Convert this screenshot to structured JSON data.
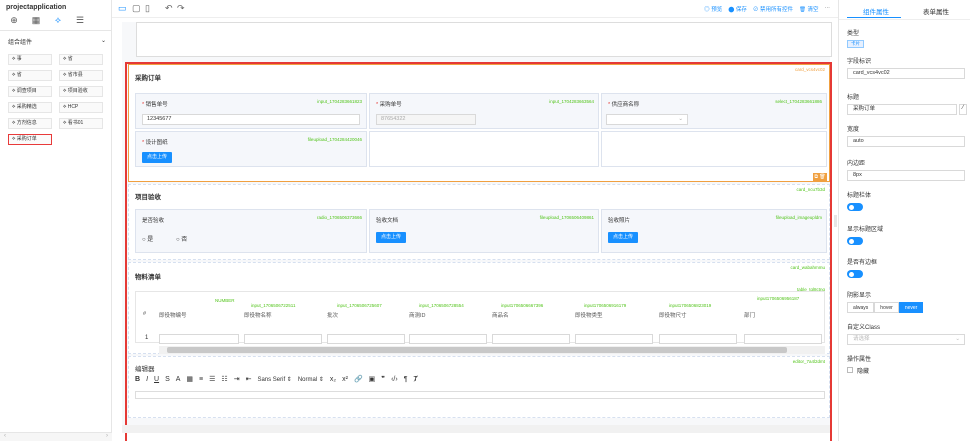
{
  "app": {
    "title": "projectapplication"
  },
  "left": {
    "tabs": [
      {
        "icon": "grid-icon"
      },
      {
        "icon": "blocks-icon"
      },
      {
        "icon": "component-icon"
      },
      {
        "icon": "list-icon"
      }
    ],
    "group_title": "组合组件",
    "group_chevron": "⌄",
    "components": [
      "事",
      "省",
      "省市县",
      "调查项目",
      "项目验收",
      "采购精选",
      "HCP",
      "方剂信息",
      "看书01",
      "采购订单"
    ],
    "scroll_left": "‹",
    "scroll_right": "›"
  },
  "toolbar": {
    "preview": "预览",
    "save": "保存",
    "disable_all": "禁用所有控件",
    "clear": "清空",
    "more": "···"
  },
  "sections": {
    "purchase": {
      "title": "采购订单",
      "id": "card_vcs4vc02",
      "f1_label": "销售单号",
      "f1_id": "input_1704283661823",
      "f1_value": "12345677",
      "f2_label": "采购单号",
      "f2_id": "input_1704283663564",
      "f2_value": "87654322",
      "f3_label": "供应商名称",
      "f3_id": "select_1704283661886",
      "f4_label": "设计图纸",
      "f4_id": "fileupload_1704284420046",
      "f4_btn": "点击上传"
    },
    "acceptance": {
      "title": "项目验收",
      "id": "card_ncu7b3d",
      "f1_label": "是否验收",
      "f1_id": "radio_1706506373666",
      "opt_yes": "是",
      "opt_no": "否",
      "f2_label": "验收文档",
      "f2_id": "fileupload_1706506409861",
      "f2_btn": "点击上传",
      "f3_label": "验收照片",
      "f3_id": "fileupload_imageupldm",
      "f3_btn": "点击上传"
    },
    "materials": {
      "title": "物料清单",
      "id": "card_wabahmmu",
      "table_id": "table_tgl8ctng",
      "headers": [
        "#",
        "即役物编号",
        "即役物名称",
        "批次",
        "商测ID",
        "商品名",
        "即役物类型",
        "即役物尺寸",
        "部门"
      ],
      "header_ids": [
        "NUMBER",
        "input_1706506722511",
        "input_1706506725607",
        "input_1706506728554",
        "input1706506667396",
        "input1706506916179",
        "input1706506823019",
        "input1706506956187"
      ],
      "row_num": "1"
    },
    "editor": {
      "title": "编辑器",
      "id": "editor_7a4l2dmt",
      "font": "Sans Serif",
      "size": "Normal"
    }
  },
  "right_panel": {
    "tab_component": "组件属性",
    "tab_form": "表单属性",
    "type_label": "类型",
    "type_value": "卡片",
    "field_label": "字段标识",
    "field_value": "card_vcs4vc02",
    "title_label": "标题",
    "title_value": "采购订单",
    "width_label": "宽度",
    "width_value": "auto",
    "padding_label": "内边距",
    "padding_value": "8px",
    "title_bar_label": "标题栏体",
    "show_title_label": "显示标题区域",
    "border_label": "是否有边框",
    "shadow_label": "阴影显示",
    "shadow_opts": [
      "always",
      "hover",
      "never"
    ],
    "shadow_selected": "never",
    "class_label": "自定义Class",
    "class_placeholder": "请选择",
    "ops_label": "操作属性",
    "hide_label": "隐藏"
  },
  "colors": {
    "accent": "#1890ff",
    "highlight": "#e53935",
    "id_green": "#52c41a"
  }
}
